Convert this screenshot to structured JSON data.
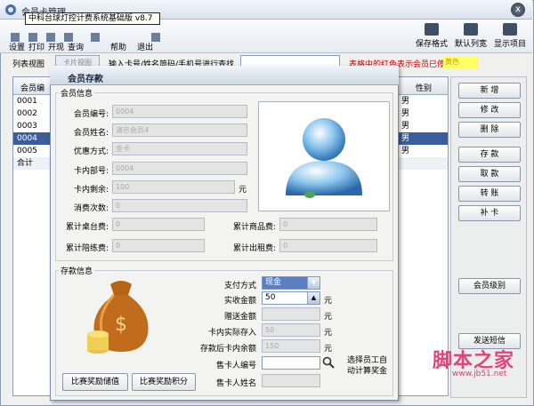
{
  "window": {
    "title": "会员卡管理",
    "close_symbol": "x"
  },
  "toolbar": {
    "banner": "中科台球灯控计费系统基础版 v8.7",
    "left_items": [
      "设置",
      "打印",
      "开现",
      "查询",
      "帮助",
      "退出"
    ],
    "right_buttons": [
      {
        "label": "保存格式",
        "icon": "save-format-icon"
      },
      {
        "label": "默认列宽",
        "icon": "column-width-icon"
      },
      {
        "label": "显示项目",
        "icon": "display-items-icon"
      }
    ]
  },
  "filterbar": {
    "list_view_tab": "列表视图",
    "second_tab": "卡片视图",
    "search_label": "输入卡号/姓名简码/手机号进行查找",
    "search_value": "",
    "legend_red": "表格中的红色表示会员已停用",
    "legend_yellow": "黄色"
  },
  "grid": {
    "header_first": "会员编",
    "header_gender": "性别",
    "rows": [
      {
        "id": "0001",
        "gender": "男"
      },
      {
        "id": "0002",
        "gender": "男"
      },
      {
        "id": "0003",
        "gender": "男"
      },
      {
        "id": "0004",
        "gender": "男"
      },
      {
        "id": "0005",
        "gender": "男"
      },
      {
        "id": "合计",
        "gender": ""
      }
    ],
    "selected_row": "0004"
  },
  "right_panel": {
    "buttons": [
      "新 增",
      "修 改",
      "删 除",
      "存 款",
      "取 款",
      "转 账",
      "补 卡",
      "会员级别",
      "发送短信"
    ]
  },
  "dialog": {
    "title": "会员存款",
    "member_info": {
      "group_label": "会员信息",
      "fields": [
        {
          "label": "会员编号:",
          "value": "0004"
        },
        {
          "label": "会员姓名:",
          "value": "演示会员4"
        },
        {
          "label": "优惠方式:",
          "value": "金卡"
        },
        {
          "label": "卡内部号:",
          "value": "0004"
        },
        {
          "label": "卡内剩余:",
          "value": "100",
          "unit": "元"
        },
        {
          "label": "消费次数:",
          "value": "0"
        }
      ],
      "stats": [
        {
          "label": "累计桌台费:",
          "value": "0"
        },
        {
          "label": "累计商品费:",
          "value": "0"
        },
        {
          "label": "累计陪练费:",
          "value": "0"
        },
        {
          "label": "累计出租费:",
          "value": "0"
        }
      ]
    },
    "deposit_info": {
      "group_label": "存款信息",
      "payment_label": "支付方式",
      "payment_value": "现金",
      "fields": [
        {
          "label": "实收金额",
          "value": "50",
          "unit": "元",
          "editable": true
        },
        {
          "label": "赠送金额",
          "value": "",
          "unit": "元",
          "editable": false
        },
        {
          "label": "卡内实际存入",
          "value": "50",
          "unit": "元",
          "editable": false
        },
        {
          "label": "存款后卡内余额",
          "value": "150",
          "unit": "元",
          "editable": false
        },
        {
          "label": "售卡人编号",
          "value": "",
          "unit": "",
          "editable": true
        },
        {
          "label": "售卡人姓名",
          "value": "",
          "unit": "",
          "editable": false
        }
      ],
      "note_line1": "选择员工自",
      "note_line2": "动计算奖金",
      "buttons": [
        "比赛奖励储值",
        "比赛奖励积分"
      ]
    }
  },
  "watermark": {
    "text": "脚本之家",
    "url": "www.jb51.net"
  }
}
